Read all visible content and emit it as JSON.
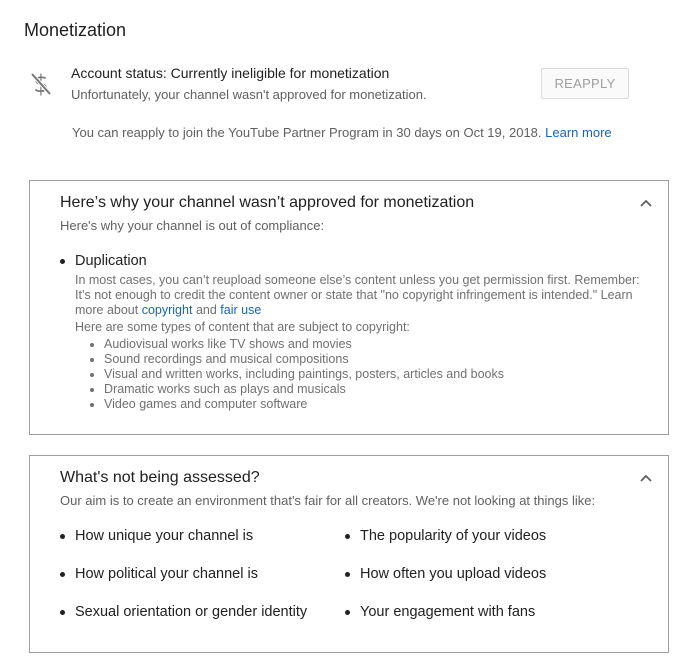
{
  "page": {
    "title": "Monetization"
  },
  "status": {
    "icon": "no-dollar-icon",
    "line": "Account status: Currently ineligible for monetization",
    "sub": "Unfortunately, your channel wasn't approved for monetization.",
    "reapply_button": "REAPPLY",
    "reapply_text": "You can reapply to join the YouTube Partner Program in 30 days on Oct 19, 2018.",
    "learn_more": "Learn more"
  },
  "why_panel": {
    "title": "Here’s why your channel wasn’t approved for monetization",
    "subtitle": "Here's why your channel is out of compliance:",
    "issue": {
      "title": "Duplication",
      "desc_line1": "In most cases, you can’t reupload someone else’s content unless you get permission first. Remember:",
      "desc_line2": "It’s not enough to credit the content owner or state that \"no copyright infringement is intended.\" Learn",
      "desc_prefix": "more about",
      "link_copyright": "copyright",
      "and": "and",
      "link_fair_use": "fair use",
      "types_intro": "Here are some types of content that are subject to copyright:",
      "types": [
        "Audiovisual works like TV shows and movies",
        "Sound recordings and musical compositions",
        "Visual and written works, including paintings, posters, articles and books",
        "Dramatic works such as plays and musicals",
        "Video games and computer software"
      ]
    }
  },
  "not_assessed_panel": {
    "title": "What's not being assessed?",
    "subtitle": "Our aim is to create an environment that's fair for all creators. We're not looking at things like:",
    "items": [
      "How unique your channel is",
      "The popularity of your videos",
      "How political your channel is",
      "How often you upload videos",
      "Sexual orientation or gender identity",
      "Your engagement with fans"
    ]
  },
  "colors": {
    "link": "#1565c0",
    "border": "#9e9e9e",
    "secondary_text": "#606060"
  }
}
